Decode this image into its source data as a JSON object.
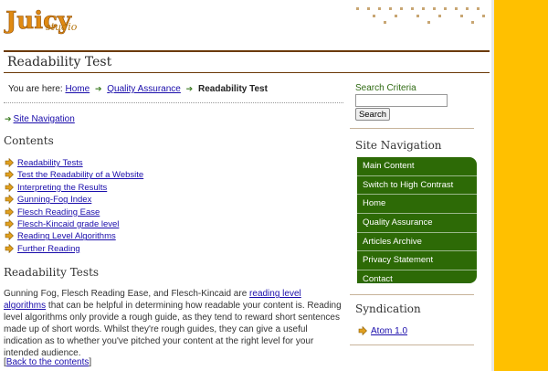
{
  "site": {
    "logo_text": "Juicy",
    "logo_sub": "studio"
  },
  "page": {
    "title": "Readability Test"
  },
  "breadcrumb": {
    "prefix": "You are here:",
    "items": [
      {
        "label": "Home"
      },
      {
        "label": "Quality Assurance"
      },
      {
        "label": "Readability Test",
        "current": true
      }
    ]
  },
  "skip_link": "Site Navigation",
  "contents": {
    "heading": "Contents",
    "items": [
      "Readability Tests",
      "Test the Readability of a Website",
      "Interpreting the Results",
      "Gunning-Fog Index",
      "Flesch Reading Ease",
      "Flesch-Kincaid grade level",
      "Reading Level Algorithms",
      "Further Reading"
    ]
  },
  "section": {
    "heading": "Readability Tests",
    "text_before": "Gunning Fog, Flesch Reading Ease, and Flesch-Kincaid are ",
    "link": "reading level algorithms",
    "text_after": " that can be helpful in determining how readable your content is. Reading level algorithms only provide a rough guide, as they tend to reward short sentences made up of short words. Whilst they're rough guides, they can give a useful indication as to whether you've pitched your content at the right level for your intended audience.",
    "back_open": "[",
    "back_link": "Back to the contents",
    "back_close": "]"
  },
  "search": {
    "label": "Search Criteria",
    "value": "",
    "button": "Search"
  },
  "site_nav": {
    "heading": "Site Navigation",
    "items": [
      "Main Content",
      "Switch to High Contrast",
      "Home",
      "Quality Assurance",
      "Articles Archive",
      "Privacy Statement",
      "Contact"
    ]
  },
  "syndication": {
    "heading": "Syndication",
    "items": [
      "Atom 1.0"
    ]
  },
  "colors": {
    "accent_stripe": "#ffc000",
    "nav_green": "#2d6a06",
    "title_rule": "#6b3a08",
    "link": "#1a0dab"
  },
  "icons": {
    "breadcrumb_sep": "green-arrow-icon",
    "list_bullet": "orange-arrow-icon"
  }
}
